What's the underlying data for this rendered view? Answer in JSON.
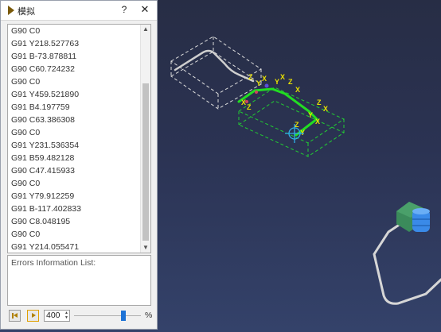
{
  "window": {
    "title": "模拟",
    "help_label": "?",
    "close_label": "✕"
  },
  "code_lines": [
    "G90 C0",
    "G91 Y218.527763",
    "G91 B-73.878811",
    "G90 C60.724232",
    "G90 C0",
    "G91 Y459.521890",
    "G91 B4.197759",
    "G90 C63.386308",
    "G90 C0",
    "G91 Y231.536354",
    "G91 B59.482128",
    "G90 C47.415933",
    "G90 C0",
    "G91 Y79.912259",
    "G91 B-117.402833",
    "G90 C8.048195",
    "G90 C0",
    "G91 Y214.055471",
    ""
  ],
  "errors_label": "Errors Information List:",
  "speed_value": "400",
  "speed_unit": "%",
  "speed_level_fraction": 0.75,
  "icons": {
    "first": "skip-to-start-icon",
    "play": "play-icon",
    "title": "play-icon"
  },
  "colors": {
    "axis_label": "#e8e000",
    "axis_line": "#22dd22",
    "ghost_box": "#dddddd",
    "cube": "#3a8a5a",
    "tool": "#3a8ae8"
  }
}
